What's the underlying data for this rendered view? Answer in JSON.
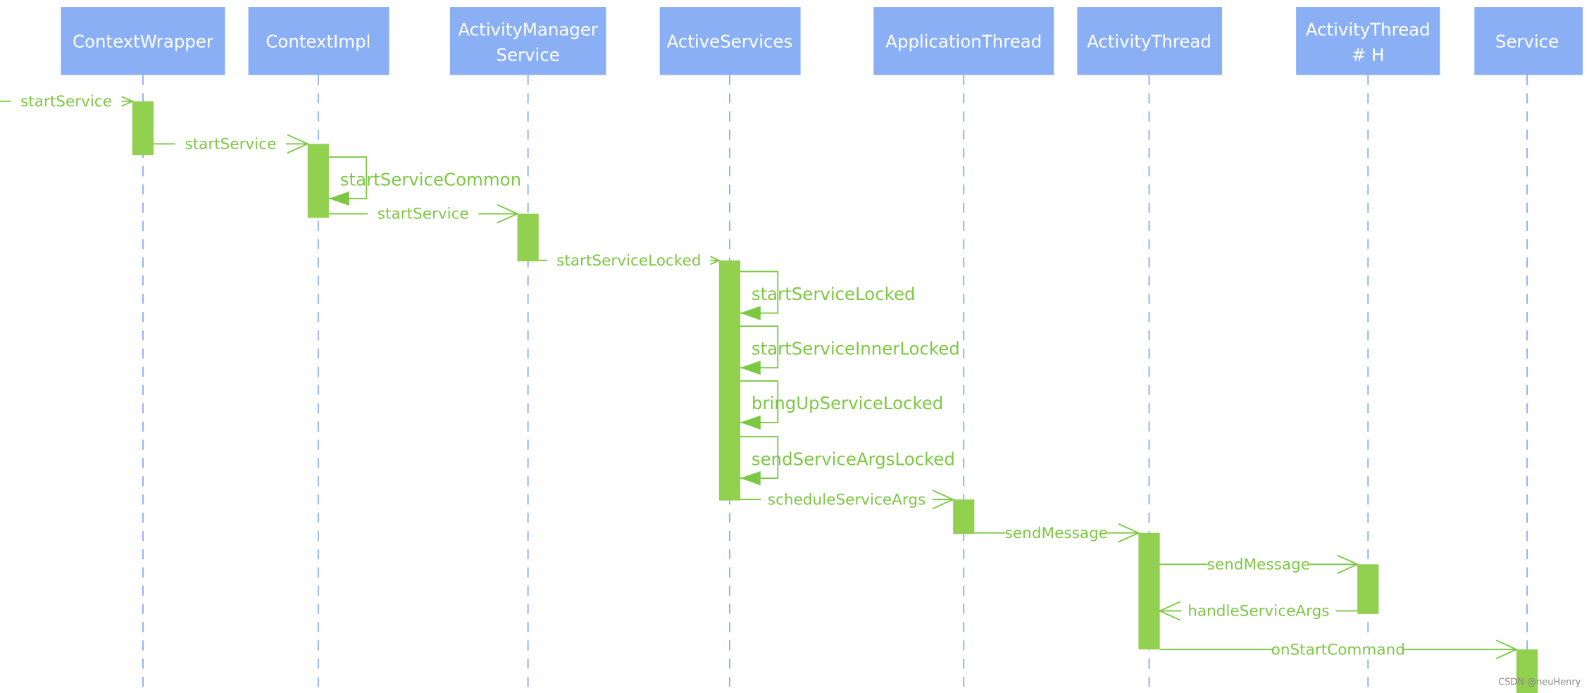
{
  "colors": {
    "participant_fill": "#8aaff5",
    "lifeline": "#8aaff5",
    "activation": "#92d050",
    "message": "#7dc843"
  },
  "participants": [
    {
      "lines": [
        "ContextWrapper"
      ]
    },
    {
      "lines": [
        "ContextImpl"
      ]
    },
    {
      "lines": [
        "ActivityManager",
        "Service"
      ]
    },
    {
      "lines": [
        "ActiveServices"
      ]
    },
    {
      "lines": [
        "ApplicationThread"
      ]
    },
    {
      "lines": [
        "ActivityThread"
      ]
    },
    {
      "lines": [
        "ActivityThread",
        "# H"
      ]
    },
    {
      "lines": [
        "Service"
      ]
    }
  ],
  "messages": [
    {
      "from": null,
      "to": 0,
      "label": "startService",
      "kind": "call"
    },
    {
      "from": 0,
      "to": 1,
      "label": "startService",
      "kind": "call"
    },
    {
      "from": 1,
      "to": 1,
      "label": "startServiceCommon",
      "kind": "self"
    },
    {
      "from": 1,
      "to": 2,
      "label": "startService",
      "kind": "call"
    },
    {
      "from": 2,
      "to": 3,
      "label": "startServiceLocked",
      "kind": "call"
    },
    {
      "from": 3,
      "to": 3,
      "label": "startServiceLocked",
      "kind": "self"
    },
    {
      "from": 3,
      "to": 3,
      "label": "startServiceInnerLocked",
      "kind": "self"
    },
    {
      "from": 3,
      "to": 3,
      "label": "bringUpServiceLocked",
      "kind": "self"
    },
    {
      "from": 3,
      "to": 3,
      "label": "sendServiceArgsLocked",
      "kind": "self"
    },
    {
      "from": 3,
      "to": 4,
      "label": "scheduleServiceArgs",
      "kind": "call"
    },
    {
      "from": 4,
      "to": 5,
      "label": "sendMessage",
      "kind": "call"
    },
    {
      "from": 5,
      "to": 6,
      "label": "sendMessage",
      "kind": "call"
    },
    {
      "from": 6,
      "to": 5,
      "label": "handleServiceArgs",
      "kind": "return"
    },
    {
      "from": 5,
      "to": 7,
      "label": "onStartCommand",
      "kind": "call"
    }
  ],
  "watermark": "CSDN @neuHenry"
}
